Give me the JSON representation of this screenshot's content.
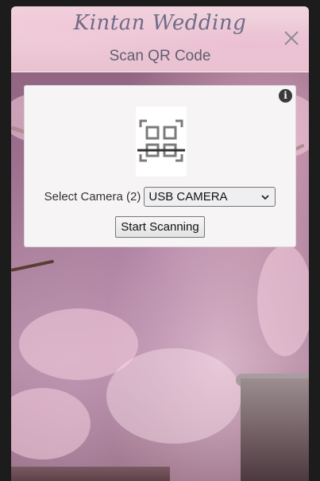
{
  "header": {
    "brand": "Kintan Wedding",
    "title": "Scan QR Code"
  },
  "scanner": {
    "camera_label": "Select Camera (2)",
    "camera_selected": "USB CAMERA",
    "start_label": "Start Scanning",
    "info_symbol": "i"
  },
  "icons": {
    "close": "close-icon",
    "info": "info-icon",
    "qr": "qr-code-icon",
    "dropdown": "chevron-down-icon"
  },
  "colors": {
    "brand_text": "#6e6c86",
    "title_text": "#5f5f6f",
    "card_bg": "#f6f4f5",
    "page_bg": "#1c1c1c"
  }
}
